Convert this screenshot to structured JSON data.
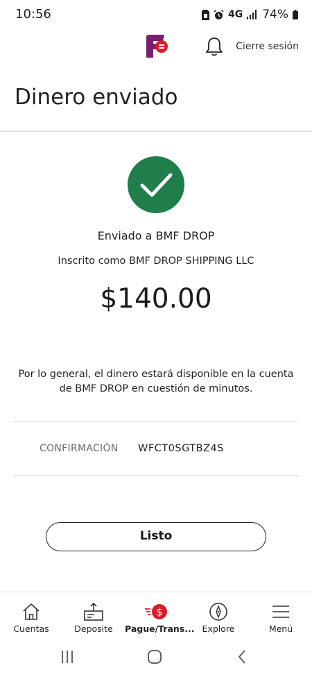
{
  "status_bar": {
    "time": "10:56",
    "network": "4G",
    "battery": "74%"
  },
  "header": {
    "logout_label": "Cierre sesión",
    "brand_color": "#d71e28",
    "logo_color": "#7a1f6f"
  },
  "page": {
    "title": "Dinero enviado",
    "sent_to": "Enviado a BMF DROP",
    "enrolled_as": "Inscrito como BMF DROP SHIPPING LLC",
    "amount": "$140.00",
    "info_text": "Por lo general, el dinero estará disponible en la cuenta de BMF DROP en cuestión de minutos.",
    "success_color": "#1f7e4a"
  },
  "confirmation": {
    "label": "CONFIRMACIÓN",
    "value": "WFCT0SGTBZ4S"
  },
  "actions": {
    "done_label": "Listo"
  },
  "bottom_nav": {
    "items": [
      {
        "label": "Cuentas",
        "icon": "home-icon",
        "active": false
      },
      {
        "label": "Deposite",
        "icon": "deposit-icon",
        "active": false
      },
      {
        "label": "Pague/Trans...",
        "icon": "pay-transfer-icon",
        "active": true
      },
      {
        "label": "Explore",
        "icon": "compass-icon",
        "active": false
      },
      {
        "label": "Menú",
        "icon": "hamburger-menu-icon",
        "active": false
      }
    ]
  }
}
